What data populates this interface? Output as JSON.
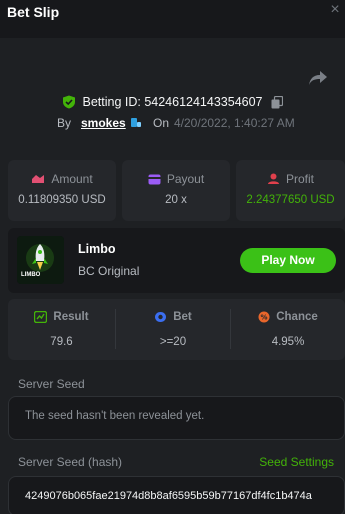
{
  "header": {
    "title": "Bet Slip",
    "close_glyph": "×"
  },
  "bet": {
    "id_text": "Betting ID: 54246124143354607",
    "by_label": "By",
    "username": "smokes",
    "on_label": "On",
    "timestamp": "4/20/2022, 1:40:27 AM"
  },
  "stats": {
    "amount": {
      "label": "Amount",
      "value": "0.11809350 USD"
    },
    "payout": {
      "label": "Payout",
      "value": "20 x"
    },
    "profit": {
      "label": "Profit",
      "value": "2.24377650 USD"
    }
  },
  "game": {
    "name": "Limbo",
    "subtitle": "BC Original",
    "thumb_text": "LIMBO",
    "play_label": "Play Now"
  },
  "result": {
    "result": {
      "label": "Result",
      "value": "79.6"
    },
    "bet": {
      "label": "Bet",
      "value": ">=20"
    },
    "chance": {
      "label": "Chance",
      "value": "4.95%"
    }
  },
  "seeds": {
    "server_seed_label": "Server Seed",
    "server_seed_value": "The seed hasn't been revealed yet.",
    "server_hash_label": "Server Seed (hash)",
    "seed_settings_label": "Seed Settings",
    "server_hash_value": "4249076b065fae21974d8b8af6595b59b77167df4fc1b474a"
  },
  "colors": {
    "background": "#1e2023",
    "card": "#25272b",
    "accent_green": "#3bc117",
    "profit_green": "#43b309"
  },
  "icons": [
    "close-icon",
    "share-icon",
    "shield-check-icon",
    "copy-icon",
    "user-badge-icon",
    "amount-icon",
    "payout-icon",
    "profit-icon",
    "result-icon",
    "bet-icon",
    "chance-icon"
  ]
}
